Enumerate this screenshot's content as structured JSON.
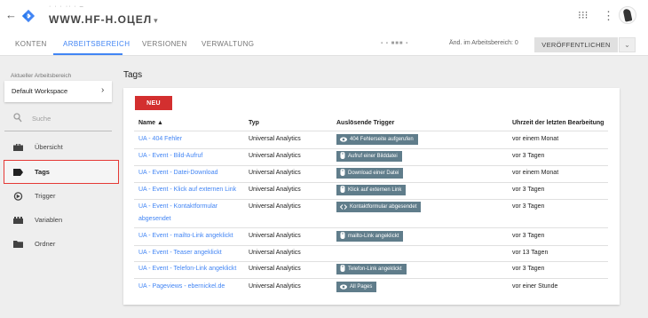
{
  "topbar": {
    "back_icon": "arrow-left-icon",
    "logo_icon": "gtm-diamond-logo",
    "account_name": "· ·  · ··  · –",
    "container_name": "WWW.HF-H.ОЦЕЛ",
    "container_caret": "▾",
    "apps_icon": "apps-grid-icon",
    "more_icon": "more-vert-icon",
    "apps_glyph": "⁝⁝⁝",
    "more_glyph": "⋮"
  },
  "tabs": [
    {
      "label": "KONTEN"
    },
    {
      "label": "ARBEITSBEREICH"
    },
    {
      "label": "VERSIONEN"
    },
    {
      "label": "VERWALTUNG"
    }
  ],
  "header_right": {
    "env_text": "▪ ▪ ■■■ ▪",
    "changes": "Änd. im Arbeitsbereich: 0",
    "publish_label": "VERÖFFENTLICHEN",
    "publish_dropdown": "⌄"
  },
  "sidebar": {
    "workspace_label": "Aktueller Arbeitsbereich",
    "workspace_name": "Default Workspace",
    "workspace_chevron": "›",
    "search_placeholder": "Suche",
    "items": [
      {
        "label": "Übersicht",
        "icon": "briefcase-icon"
      },
      {
        "label": "Tags",
        "icon": "tag-icon"
      },
      {
        "label": "Trigger",
        "icon": "trigger-icon"
      },
      {
        "label": "Variablen",
        "icon": "variables-icon"
      },
      {
        "label": "Ordner",
        "icon": "folder-icon"
      }
    ]
  },
  "main": {
    "title": "Tags",
    "new_button": "NEU",
    "columns": [
      "Name ▲",
      "Typ",
      "Auslösende Trigger",
      "Uhrzeit der letzten Bearbeitung"
    ],
    "rows": [
      {
        "name": "UA - 404 Fehler",
        "type": "Universal Analytics",
        "trigger": "404 Fehlerseite aufgerufen",
        "trigger_icon": "eye-icon",
        "time": "vor einem Monat"
      },
      {
        "name": "UA - Event - Bild-Aufruf",
        "type": "Universal Analytics",
        "trigger": "Aufruf einer Bilddatei",
        "trigger_icon": "click-icon",
        "time": "vor 3 Tagen"
      },
      {
        "name": "UA - Event - Datei-Download",
        "type": "Universal Analytics",
        "trigger": "Download einer Datei",
        "trigger_icon": "click-icon",
        "time": "vor einem Monat"
      },
      {
        "name": "UA - Event - Klick auf externen Link",
        "type": "Universal Analytics",
        "trigger": "Klick auf externen Link",
        "trigger_icon": "click-icon",
        "time": "vor 3 Tagen"
      },
      {
        "name": "UA - Event - Kontaktformular",
        "name_line2": "abgesendet",
        "type": "Universal Analytics",
        "trigger": "Kontaktformular abgesendet",
        "trigger_icon": "code-icon",
        "time": "vor 3 Tagen"
      },
      {
        "name": "UA - Event - mailto-Link angeklickt",
        "type": "Universal Analytics",
        "trigger": "mailto-Link angeklickt",
        "trigger_icon": "click-icon",
        "time": "vor 3 Tagen"
      },
      {
        "name": "UA - Event - Teaser angeklickt",
        "type": "Universal Analytics",
        "trigger": "",
        "trigger_icon": "",
        "time": "vor 13 Tagen"
      },
      {
        "name": "UA - Event - Telefon-Link angeklickt",
        "type": "Universal Analytics",
        "trigger": "Telefon-Link angeklickt",
        "trigger_icon": "click-icon",
        "time": "vor 3 Tagen"
      },
      {
        "name": "UA - Pageviews - ebernickel.de",
        "type": "Universal Analytics",
        "trigger": "All Pages",
        "trigger_icon": "eye-icon",
        "time": "vor einer Stunde"
      }
    ]
  },
  "colors": {
    "accent_blue": "#4285f4",
    "new_button_red": "#d32f2f",
    "chip_grey": "#607d8b",
    "active_outline": "#e53935"
  }
}
